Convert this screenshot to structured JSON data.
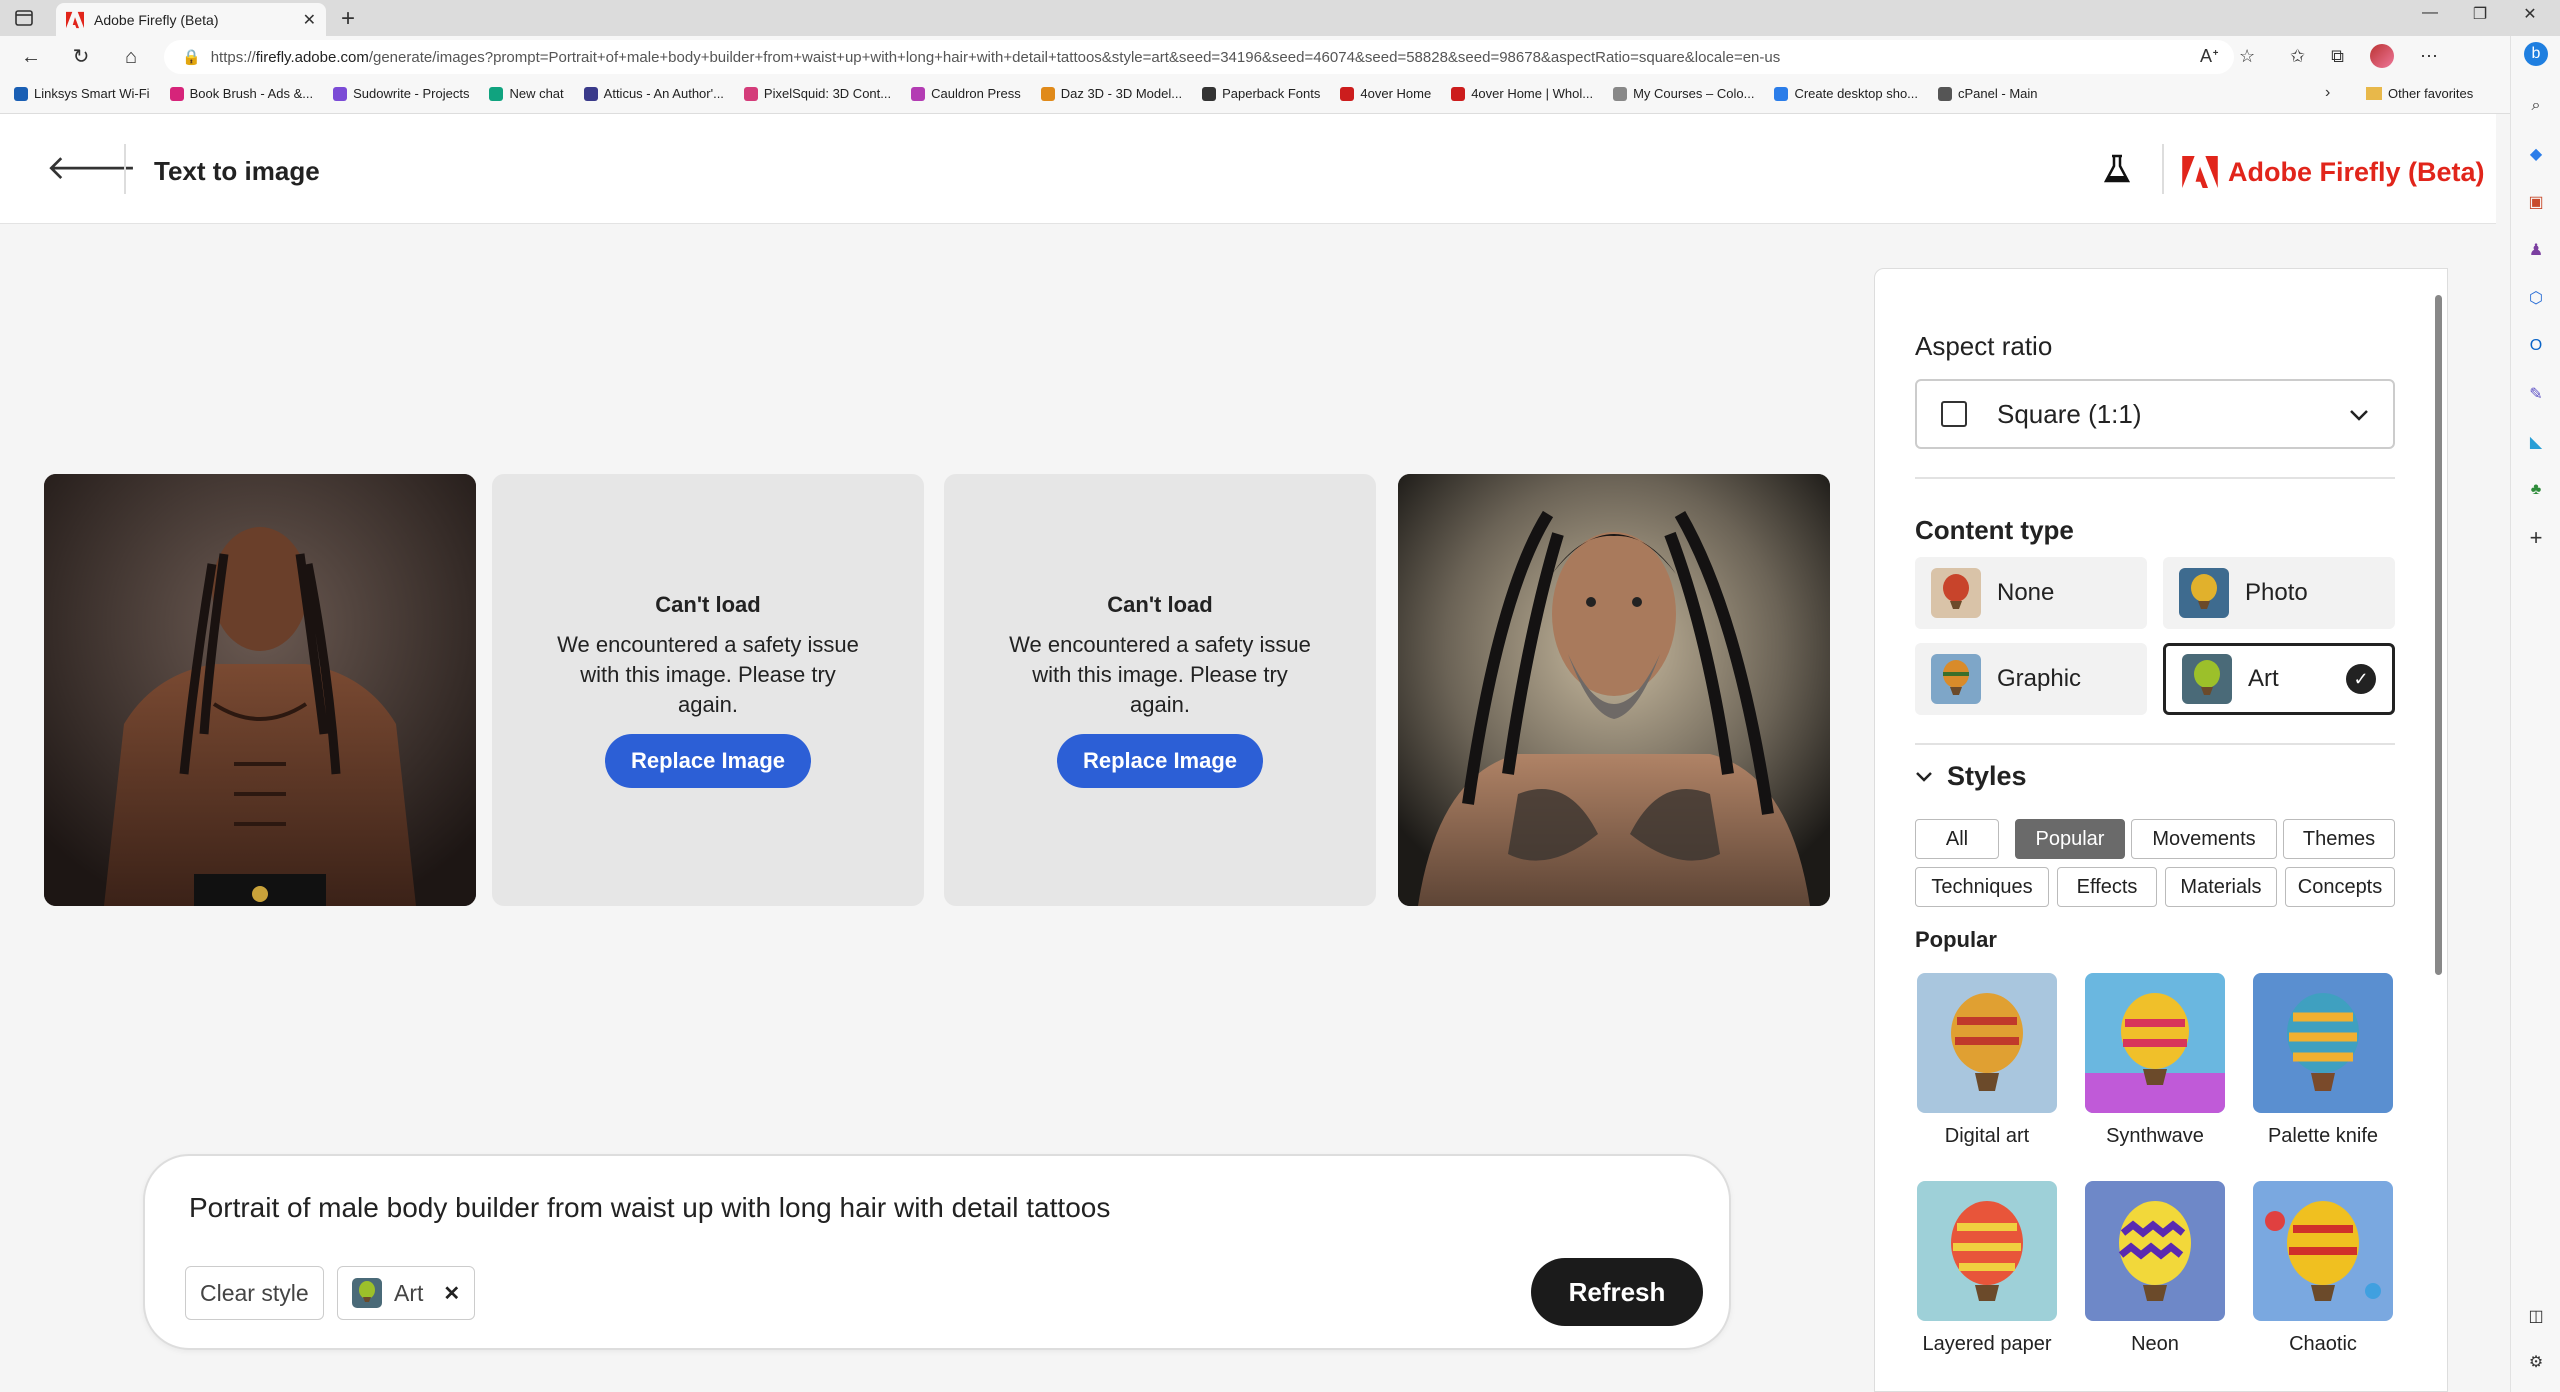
{
  "browser": {
    "tab_title": "Adobe Firefly (Beta)",
    "new_tab_symbol": "+",
    "close_symbol": "✕",
    "url_prefix": "https://",
    "url_host": "firefly.adobe.com",
    "url_path": "/generate/images?prompt=Portrait+of+male+body+builder+from+waist+up+with+long+hair+with+detail+tattoos&style=art&seed=34196&seed=46074&seed=58828&seed=98678&aspectRatio=square&locale=en-us",
    "bookmarks": [
      {
        "label": "Linksys Smart Wi-Fi",
        "color": "#1a5fb4"
      },
      {
        "label": "Book Brush - Ads &...",
        "color": "#d6247a"
      },
      {
        "label": "Sudowrite - Projects",
        "color": "#7b4bd6"
      },
      {
        "label": "New chat",
        "color": "#10a37f"
      },
      {
        "label": "Atticus - An Author'...",
        "color": "#3a3a8a"
      },
      {
        "label": "PixelSquid: 3D Cont...",
        "color": "#d43c7a"
      },
      {
        "label": "Cauldron Press",
        "color": "#b33cb3"
      },
      {
        "label": "Daz 3D - 3D Model...",
        "color": "#e08a1a"
      },
      {
        "label": "Paperback Fonts",
        "color": "#333333"
      },
      {
        "label": "4over Home",
        "color": "#cc1d1d"
      },
      {
        "label": "4over Home | Whol...",
        "color": "#cc1d1d"
      },
      {
        "label": "My Courses – Colo...",
        "color": "#888888"
      },
      {
        "label": "Create desktop sho...",
        "color": "#2b7de9"
      },
      {
        "label": "cPanel - Main",
        "color": "#555555"
      }
    ],
    "other_favorites": "Other favorites"
  },
  "header": {
    "title": "Text to image",
    "brand": "Adobe Firefly (Beta)",
    "brand_color": "#e1251b"
  },
  "results": {
    "error_cards": [
      {
        "title": "Can't load",
        "message": "We encountered a safety issue with this image. Please try again.",
        "button": "Replace Image"
      },
      {
        "title": "Can't load",
        "message": "We encountered a safety issue with this image. Please try again.",
        "button": "Replace Image"
      }
    ]
  },
  "prompt": {
    "text": "Portrait of male body builder from waist up with long hair with detail tattoos",
    "clear_style": "Clear style",
    "style_chip": "Art",
    "refresh": "Refresh"
  },
  "panel": {
    "aspect_ratio_heading": "Aspect ratio",
    "aspect_ratio_value": "Square (1:1)",
    "content_type_heading": "Content type",
    "content_types": [
      {
        "label": "None",
        "selected": false
      },
      {
        "label": "Photo",
        "selected": false
      },
      {
        "label": "Graphic",
        "selected": false
      },
      {
        "label": "Art",
        "selected": true
      }
    ],
    "styles_heading": "Styles",
    "style_tabs": [
      "All",
      "Popular",
      "Movements",
      "Themes",
      "Techniques",
      "Effects",
      "Materials",
      "Concepts"
    ],
    "active_style_tab": "Popular",
    "popular_heading": "Popular",
    "popular_styles": [
      "Digital art",
      "Synthwave",
      "Palette knife",
      "Layered paper",
      "Neon",
      "Chaotic"
    ]
  }
}
